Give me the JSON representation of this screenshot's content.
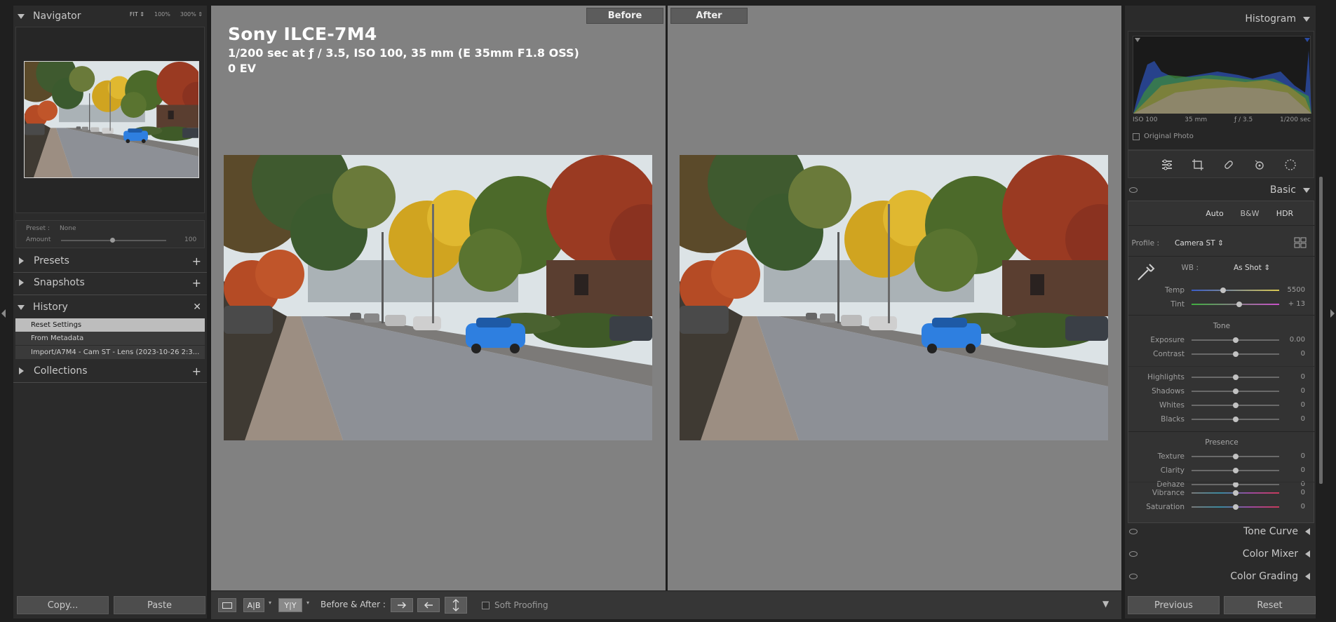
{
  "left_panel": {
    "navigator": {
      "title": "Navigator",
      "zoom_fit": "FIT ⇕",
      "zoom_100": "100%",
      "zoom_300": "300% ⇕"
    },
    "preset": {
      "label": "Preset :",
      "value": "None",
      "amount_label": "Amount",
      "amount_value": "100"
    },
    "presets": {
      "title": "Presets"
    },
    "snapshots": {
      "title": "Snapshots"
    },
    "history": {
      "title": "History",
      "items": [
        "Reset Settings",
        "From Metadata",
        "Import/A7M4 - Cam ST - Lens (2023-10-26 2:3..."
      ]
    },
    "collections": {
      "title": "Collections"
    },
    "copy_label": "Copy...",
    "paste_label": "Paste"
  },
  "center": {
    "before_label": "Before",
    "after_label": "After",
    "camera": {
      "model": "Sony ILCE-7M4",
      "exposure": "1/200 sec at ƒ / 3.5, ISO 100, 35 mm (E 35mm F1.8 OSS)",
      "ev": "0 EV"
    }
  },
  "toolbar": {
    "yy_label": "Y|Y",
    "ab_label": "A|B",
    "before_after_label": "Before & After :",
    "soft_proofing_label": "Soft Proofing"
  },
  "right_panel": {
    "histogram": {
      "title": "Histogram",
      "iso": "ISO 100",
      "focal": "35 mm",
      "aperture": "ƒ / 3.5",
      "shutter": "1/200 sec",
      "original_photo": "Original Photo"
    },
    "basic": {
      "title": "Basic",
      "auto": "Auto",
      "bw": "B&W",
      "hdr": "HDR",
      "profile_label": "Profile :",
      "profile_value": "Camera ST ⇕",
      "wb_label": "WB :",
      "wb_value": "As Shot ⇕",
      "temp": {
        "label": "Temp",
        "value": "5500",
        "pos": 0.36
      },
      "tint": {
        "label": "Tint",
        "value": "+ 13",
        "pos": 0.54
      },
      "tone_title": "Tone",
      "presence_title": "Presence",
      "sliders_tone": [
        {
          "label": "Exposure",
          "value": "0.00",
          "pos": 0.5
        },
        {
          "label": "Contrast",
          "value": "0",
          "pos": 0.5
        }
      ],
      "sliders_tone2": [
        {
          "label": "Highlights",
          "value": "0",
          "pos": 0.5
        },
        {
          "label": "Shadows",
          "value": "0",
          "pos": 0.5
        },
        {
          "label": "Whites",
          "value": "0",
          "pos": 0.5
        },
        {
          "label": "Blacks",
          "value": "0",
          "pos": 0.5
        }
      ],
      "sliders_presence": [
        {
          "label": "Texture",
          "value": "0",
          "pos": 0.5
        },
        {
          "label": "Clarity",
          "value": "0",
          "pos": 0.5
        },
        {
          "label": "Dehaze",
          "value": "0",
          "pos": 0.5
        }
      ],
      "sliders_presence2": [
        {
          "label": "Vibrance",
          "value": "0",
          "pos": 0.5
        },
        {
          "label": "Saturation",
          "value": "0",
          "pos": 0.5
        }
      ]
    },
    "tone_curve": "Tone Curve",
    "color_mixer": "Color Mixer",
    "color_grading": "Color Grading",
    "previous_label": "Previous",
    "reset_label": "Reset"
  }
}
